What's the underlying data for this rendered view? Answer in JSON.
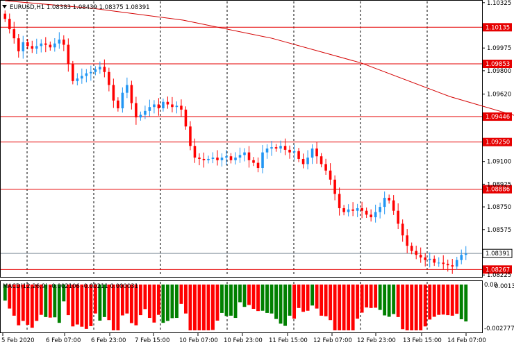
{
  "window": {
    "header": "EURUSD,H1  1.08383 1.08439 1.08375 1.08391",
    "indicator_label": "MACD(12,26,9) -0.002106 -0.00211 0.000031"
  },
  "colors": {
    "bull": "#2196f3",
    "bear": "#ff0000",
    "level_line": "#e60000",
    "ma_line": "#d40000",
    "macd_hist": "#008000",
    "macd_hist_neg": "#ff0000",
    "grid": "#000000",
    "price_tag_bg": "#ffffff"
  },
  "chart_data": {
    "type": "candlestick",
    "title": "EURUSD,H1",
    "ohlc_header": {
      "open": 1.08383,
      "high": 1.08439,
      "low": 1.08375,
      "close": 1.08391
    },
    "price_axis": {
      "ticks": [
        "1.10325",
        "1.09975",
        "1.09800",
        "1.09620",
        "1.09100",
        "1.08925",
        "1.08750",
        "1.08575",
        "1.08225"
      ],
      "ylim": [
        1.0821,
        1.1034
      ]
    },
    "time_axis": {
      "labels": [
        "5 Feb 2020",
        "6 Feb 07:00",
        "6 Feb 23:00",
        "7 Feb 15:00",
        "10 Feb 07:00",
        "10 Feb 23:00",
        "11 Feb 15:00",
        "12 Feb 07:00",
        "12 Feb 23:00",
        "13 Feb 15:00",
        "14 Feb 07:00"
      ]
    },
    "levels": [
      {
        "label": "1.10135",
        "value": 1.10135
      },
      {
        "label": "1.09853",
        "value": 1.09853
      },
      {
        "label": "1.09446",
        "value": 1.09446
      },
      {
        "label": "1.09250",
        "value": 1.0925
      },
      {
        "label": "1.08886",
        "value": 1.08886
      },
      {
        "label": "1.08267",
        "value": 1.08267
      }
    ],
    "current_price": {
      "label": "1.08391",
      "value": 1.08391
    },
    "moving_average": [
      [
        0,
        1.1034
      ],
      [
        20,
        1.1028
      ],
      [
        40,
        1.1019
      ],
      [
        60,
        1.1005
      ],
      [
        80,
        1.0986
      ],
      [
        100,
        1.096
      ],
      [
        115,
        1.0945
      ]
    ],
    "closes": [
      1.102,
      1.1012,
      1.1005,
      1.0995,
      1.1002,
      1.0999,
      1.0997,
      1.0999,
      1.1001,
      1.1,
      1.0998,
      1.1001,
      1.1004,
      1.1,
      1.0985,
      1.0972,
      1.0974,
      1.0976,
      1.0978,
      1.0979,
      1.0981,
      1.0983,
      1.0979,
      1.0969,
      1.0957,
      1.0951,
      1.0963,
      1.0969,
      1.0955,
      1.0944,
      1.0946,
      1.0949,
      1.0952,
      1.0954,
      1.0951,
      1.0956,
      1.0954,
      1.0952,
      1.0953,
      1.095,
      1.0937,
      1.0922,
      1.0913,
      1.0912,
      1.0911,
      1.0912,
      1.0913,
      1.0911,
      1.0913,
      1.0914,
      1.0911,
      1.0913,
      1.0915,
      1.0917,
      1.0911,
      1.0909,
      1.0905,
      1.0917,
      1.092,
      1.0921,
      1.092,
      1.0922,
      1.0919,
      1.0917,
      1.0918,
      1.0912,
      1.0908,
      1.0913,
      1.092,
      1.0914,
      1.0908,
      1.0903,
      1.0896,
      1.0885,
      1.0874,
      1.0871,
      1.0873,
      1.0872,
      1.0874,
      1.0872,
      1.0869,
      1.0867,
      1.0871,
      1.0875,
      1.0882,
      1.088,
      1.0872,
      1.0862,
      1.0853,
      1.0845,
      1.0841,
      1.0838,
      1.0836,
      1.0834,
      1.0835,
      1.0832,
      1.0832,
      1.0831,
      1.083,
      1.0829,
      1.0834,
      1.0838,
      1.0839
    ],
    "macd_range": {
      "top_label": "0.00",
      "top_label2": "0.001322",
      "bottom_label": "-0.002777"
    }
  }
}
